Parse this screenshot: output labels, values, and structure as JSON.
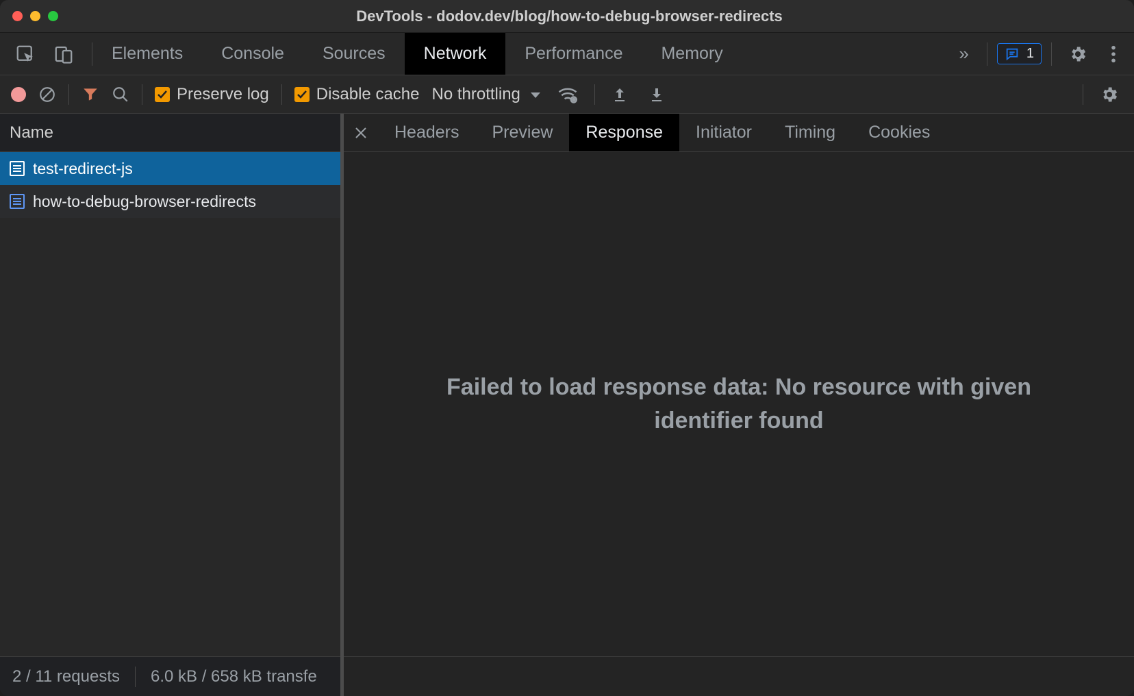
{
  "titlebar": {
    "title": "DevTools - dodov.dev/blog/how-to-debug-browser-redirects"
  },
  "mainTabs": {
    "items": [
      "Elements",
      "Console",
      "Sources",
      "Network",
      "Performance",
      "Memory"
    ],
    "active": "Network",
    "expandGlyph": "»",
    "messageCount": "1"
  },
  "netToolbar": {
    "preserveLogLabel": "Preserve log",
    "preserveLogChecked": true,
    "disableCacheLabel": "Disable cache",
    "disableCacheChecked": true,
    "throttlingLabel": "No throttling"
  },
  "requests": {
    "columnHeader": "Name",
    "items": [
      {
        "name": "test-redirect-js",
        "selected": true
      },
      {
        "name": "how-to-debug-browser-redirects",
        "selected": false
      }
    ],
    "statusRequests": "2 / 11 requests",
    "statusTransfer": "6.0 kB / 658 kB transfe"
  },
  "detail": {
    "tabs": [
      "Headers",
      "Preview",
      "Response",
      "Initiator",
      "Timing",
      "Cookies"
    ],
    "active": "Response",
    "responseMessage": "Failed to load response data: No resource with given identifier found"
  }
}
